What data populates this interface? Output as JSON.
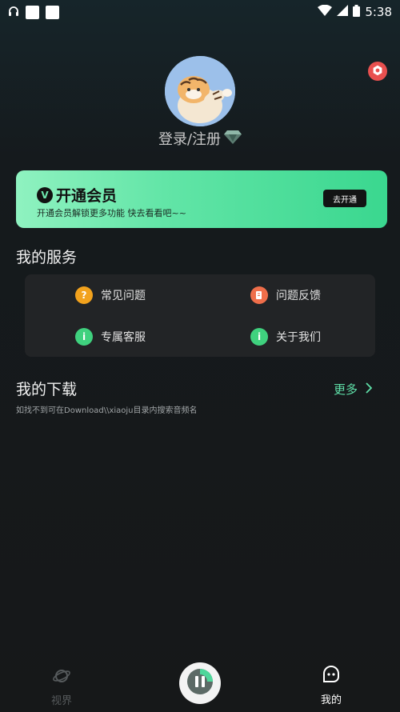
{
  "status": {
    "time": "5:38"
  },
  "profile": {
    "login_label": "登录/注册"
  },
  "vip": {
    "badge": "V",
    "title": "开通会员",
    "subtitle": "开通会员解锁更多功能 快去看看吧~~",
    "button": "去开通"
  },
  "services": {
    "title": "我的服务",
    "items": [
      {
        "label": "常见问题",
        "icon": "question-icon",
        "color": "#f2a21d"
      },
      {
        "label": "问题反馈",
        "icon": "feedback-icon",
        "color": "#ef6e4a"
      },
      {
        "label": "专属客服",
        "icon": "service-icon",
        "color": "#3fd17e"
      },
      {
        "label": "关于我们",
        "icon": "info-icon",
        "color": "#3fd17e"
      }
    ]
  },
  "downloads": {
    "title": "我的下载",
    "more": "更多",
    "hint": "如找不到可在Download\\\\xiaoju目录内搜索音频名"
  },
  "nav": {
    "items": [
      {
        "label": "视界",
        "active": false
      },
      {
        "label": "我的",
        "active": true
      }
    ]
  },
  "colors": {
    "accent": "#5fe0a8",
    "settings": "#e8504f"
  }
}
